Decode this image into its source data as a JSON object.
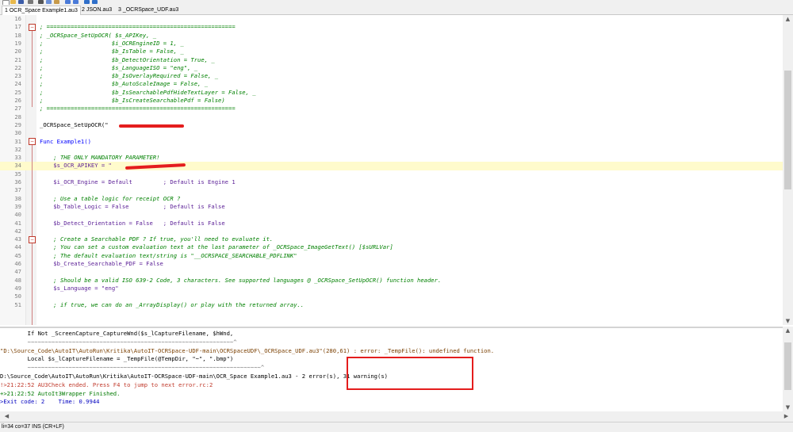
{
  "toolbar": {
    "icons": [
      "new-file-icon",
      "open-icon",
      "save-icon",
      "print-icon",
      "cut-icon",
      "copy-icon",
      "paste-icon",
      "undo-icon",
      "redo-icon",
      "find-icon",
      "replace-icon"
    ]
  },
  "tabs": [
    {
      "label": "1 OCR_Space Example1.au3",
      "active": true
    },
    {
      "label": "2 JSON.au3",
      "active": false
    },
    {
      "label": "3 _OCRSpace_UDF.au3",
      "active": false
    }
  ],
  "editor": {
    "lines": [
      {
        "num": "16",
        "text": ""
      },
      {
        "num": "17",
        "text": "; ======================================================="
      },
      {
        "num": "18",
        "text": "; _OCRSpace_SetUpOCR( $s_APIKey, _"
      },
      {
        "num": "19",
        "text": ";                    $i_OCREngineID = 1, _"
      },
      {
        "num": "20",
        "text": ";                    $b_IsTable = False, _"
      },
      {
        "num": "21",
        "text": ";                    $b_DetectOrientation = True, _"
      },
      {
        "num": "22",
        "text": ";                    $s_LanguageISO = \"eng\", _"
      },
      {
        "num": "23",
        "text": ";                    $b_IsOverlayRequired = False, _"
      },
      {
        "num": "24",
        "text": ";                    $b_AutoScaleImage = False, _"
      },
      {
        "num": "25",
        "text": ";                    $b_IsSearchablePdfHideTextLayer = False, _"
      },
      {
        "num": "26",
        "text": ";                    $b_IsCreateSearchablePdf = False)"
      },
      {
        "num": "27",
        "text": "; ======================================================="
      },
      {
        "num": "28",
        "text": ""
      },
      {
        "num": "29",
        "text": "_OCRSpace_SetUpOCR(\""
      },
      {
        "num": "30",
        "text": ""
      },
      {
        "num": "31",
        "text": "Func Example1()"
      },
      {
        "num": "32",
        "text": ""
      },
      {
        "num": "33",
        "text": "    ; THE ONLY MANDATORY PARAMETER!"
      },
      {
        "num": "34",
        "text": "    $s_OCR_APIKEY = \""
      },
      {
        "num": "35",
        "text": ""
      },
      {
        "num": "36",
        "text": "    $i_OCR_Engine = Default         ; Default is Engine 1"
      },
      {
        "num": "37",
        "text": ""
      },
      {
        "num": "38",
        "text": "    ; Use a table logic for receipt OCR ?"
      },
      {
        "num": "39",
        "text": "    $b_Table_Logic = False          ; Default is False"
      },
      {
        "num": "40",
        "text": ""
      },
      {
        "num": "41",
        "text": "    $b_Detect_Orientation = False   ; Default is False"
      },
      {
        "num": "42",
        "text": ""
      },
      {
        "num": "43",
        "text": "    ; Create a Searchable PDF ? If true, you'll need to evaluate it."
      },
      {
        "num": "44",
        "text": "    ; You can set a custom evaluation text at the last parameter of _OCRSpace_ImageGetText() [$sURLVar]"
      },
      {
        "num": "45",
        "text": "    ; The default evaluation text/string is \"__OCRSPACE_SEARCHABLE_PDFLINK\""
      },
      {
        "num": "46",
        "text": "    $b_Create_Searchable_PDF = False"
      },
      {
        "num": "47",
        "text": ""
      },
      {
        "num": "48",
        "text": "    ; Should be a valid ISO 639-2 Code, 3 characters. See supported languages @ _OCRSpace_SetUpOCR() function header."
      },
      {
        "num": "49",
        "text": "    $s_Language = \"eng\""
      },
      {
        "num": "50",
        "text": ""
      },
      {
        "num": "51",
        "text": "    ; if true, we can do an _ArrayDisplay() or play with the returned array.."
      }
    ]
  },
  "output": {
    "lines": [
      "        If Not _ScreenCapture_CaptureWnd($s_lCaptureFilename, $hWnd,",
      "        ~~~~~~~~~~~~~~~~~~~~~~~~~~~~~~~~~~~~~~~~~~~~~~~~~~~~~~~~~~~~^",
      "\"D:\\Source_Code\\AutoIT\\AutoRun\\Kritika\\AutoIT-OCRSpace-UDF-main\\OCRSpaceUDF\\_OCRSpace_UDF.au3\"(280,61) : error: _TempFile(): undefined function.",
      "        Local $s_lCaptureFilename = _TempFile(@TempDir, \"~\", \".bmp\")",
      "        ~~~~~~~~~~~~~~~~~~~~~~~~~~~~~~~~~~~~~~~~~~~~~~~~~~~~~~~~~~~~~~~~~~~~^",
      "D:\\Source_Code\\AutoIT\\AutoRun\\Kritika\\AutoIT-OCRSpace-UDF-main\\OCR_Space Example1.au3 - 2 error(s), 31 warning(s)",
      "!>21:22:52 AU3Check ended. Press F4 to jump to next error.rc:2",
      "+>21:22:52 AutoIt3Wrapper Finished.",
      ">Exit code: 2    Time: 0.9944"
    ]
  },
  "status": {
    "text": "li=34 co=37 INS (CR+LF)"
  },
  "colors": {
    "comment": "#008000",
    "keyword": "#0000ff",
    "variable": "#5a1e96",
    "redaction": "#e41d1d",
    "current_line": "#fffbcc"
  }
}
